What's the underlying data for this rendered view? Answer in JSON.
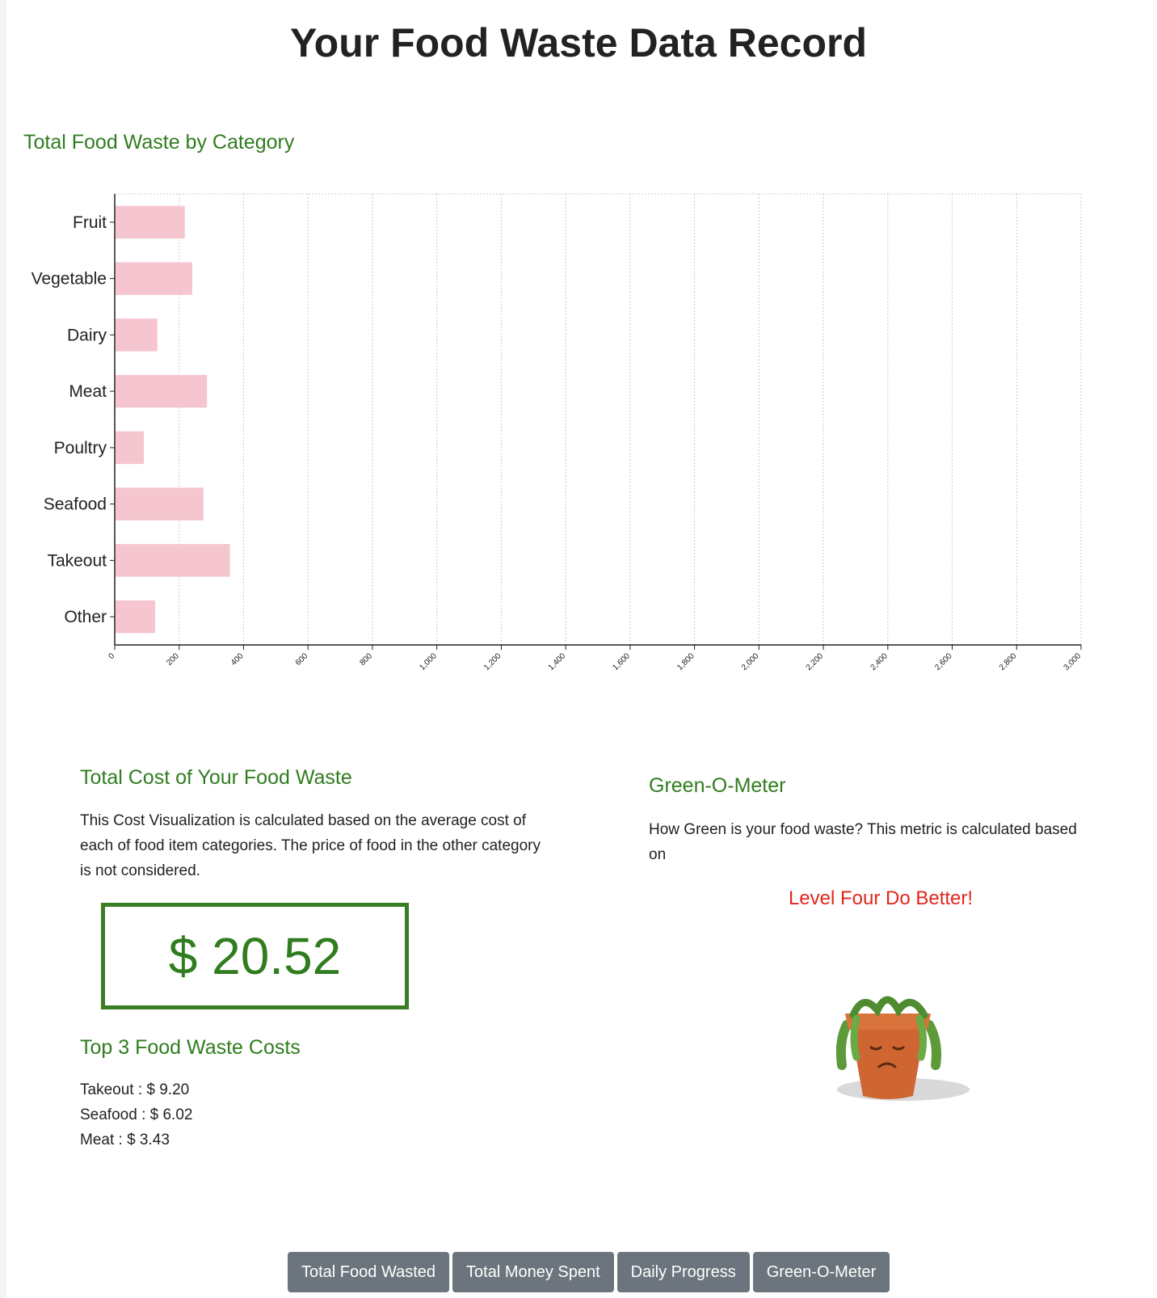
{
  "page": {
    "title": "Your Food Waste Data Record"
  },
  "chart_section": {
    "heading": "Total Food Waste by Category"
  },
  "chart_data": {
    "type": "bar",
    "orientation": "horizontal",
    "categories": [
      "Fruit",
      "Vegetable",
      "Dairy",
      "Meat",
      "Poultry",
      "Seafood",
      "Takeout",
      "Other"
    ],
    "values": [
      215,
      238,
      130,
      284,
      88,
      273,
      355,
      123
    ],
    "xlim": [
      0,
      3000
    ],
    "xticks": [
      "0",
      "200",
      "400",
      "600",
      "800",
      "1,000",
      "1,200",
      "1,400",
      "1,600",
      "1,800",
      "2,000",
      "2,200",
      "2,400",
      "2,600",
      "2,800",
      "3,000"
    ],
    "grid": true,
    "bar_color": "#f5c6cf"
  },
  "cost": {
    "heading": "Total Cost of Your Food Waste",
    "description": "This Cost Visualization is calculated based on the average cost of each of food item categories. The price of food in the other category is not considered.",
    "total": "$ 20.52",
    "top_heading": "Top 3 Food Waste Costs",
    "top_items": [
      "Takeout : $ 9.20",
      "Seafood : $ 6.02",
      "Meat : $ 3.43"
    ]
  },
  "meter": {
    "heading": "Green-O-Meter",
    "description": "How Green is your food waste? This metric is calculated based on",
    "level": "Level Four Do Better!",
    "plant_icon": "wilted-sad-plant-icon",
    "level_color": "#e3261b"
  },
  "nav": {
    "buttons": [
      "Total Food Wasted",
      "Total Money Spent",
      "Daily Progress",
      "Green-O-Meter"
    ]
  },
  "colors": {
    "accent": "#2f7d1e",
    "button": "#6c757d"
  }
}
